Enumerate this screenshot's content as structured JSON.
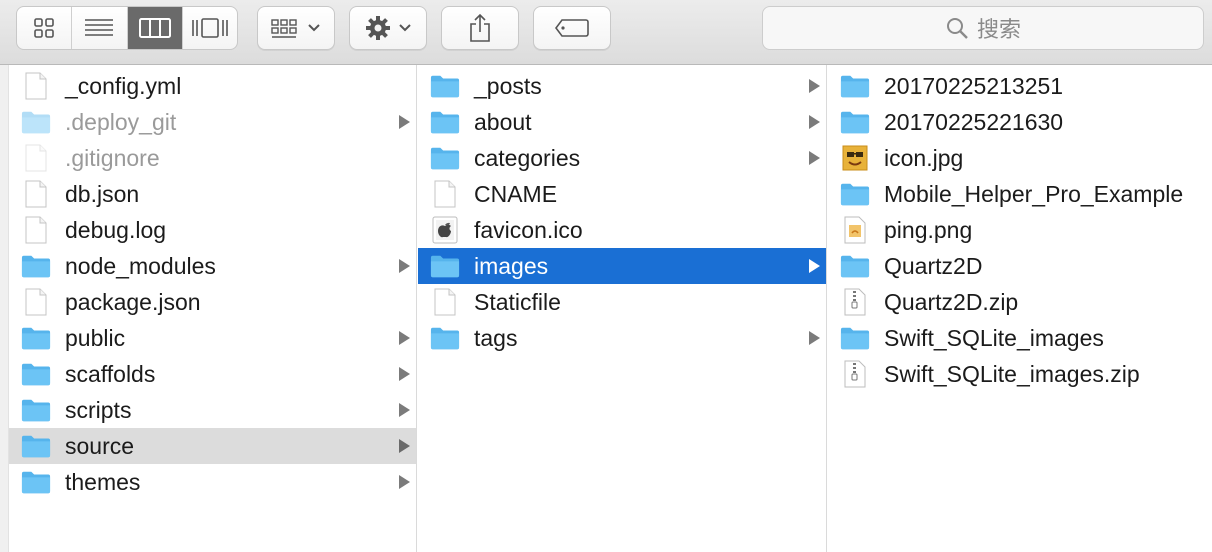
{
  "toolbar": {
    "view_modes": [
      "icon-view",
      "list-view",
      "column-view",
      "cover-flow-view"
    ],
    "active_view": "column-view",
    "search_placeholder": "搜索"
  },
  "columns": [
    {
      "items": [
        {
          "name": "_config.yml",
          "kind": "file",
          "arrow": false
        },
        {
          "name": ".deploy_git",
          "kind": "folder",
          "arrow": true,
          "dim": true
        },
        {
          "name": ".gitignore",
          "kind": "file",
          "arrow": false,
          "dim": true
        },
        {
          "name": "db.json",
          "kind": "file",
          "arrow": false
        },
        {
          "name": "debug.log",
          "kind": "file",
          "arrow": false
        },
        {
          "name": "node_modules",
          "kind": "folder",
          "arrow": true
        },
        {
          "name": "package.json",
          "kind": "file",
          "arrow": false
        },
        {
          "name": "public",
          "kind": "folder",
          "arrow": true
        },
        {
          "name": "scaffolds",
          "kind": "folder",
          "arrow": true
        },
        {
          "name": "scripts",
          "kind": "folder",
          "arrow": true
        },
        {
          "name": "source",
          "kind": "folder",
          "arrow": true,
          "selected": "inactive"
        },
        {
          "name": "themes",
          "kind": "folder",
          "arrow": true
        }
      ]
    },
    {
      "items": [
        {
          "name": "_posts",
          "kind": "folder",
          "arrow": true
        },
        {
          "name": "about",
          "kind": "folder",
          "arrow": true
        },
        {
          "name": "categories",
          "kind": "folder",
          "arrow": true
        },
        {
          "name": "CNAME",
          "kind": "file",
          "arrow": false
        },
        {
          "name": "favicon.ico",
          "kind": "ico",
          "arrow": false
        },
        {
          "name": "images",
          "kind": "folder",
          "arrow": true,
          "selected": "active"
        },
        {
          "name": "Staticfile",
          "kind": "file",
          "arrow": false
        },
        {
          "name": "tags",
          "kind": "folder",
          "arrow": true
        }
      ]
    },
    {
      "items": [
        {
          "name": "20170225213251",
          "kind": "folder",
          "arrow": false
        },
        {
          "name": "20170225221630",
          "kind": "folder",
          "arrow": false
        },
        {
          "name": "icon.jpg",
          "kind": "image",
          "arrow": false
        },
        {
          "name": "Mobile_Helper_Pro_Example",
          "kind": "folder",
          "arrow": false
        },
        {
          "name": "ping.png",
          "kind": "png",
          "arrow": false
        },
        {
          "name": "Quartz2D",
          "kind": "folder",
          "arrow": false
        },
        {
          "name": "Quartz2D.zip",
          "kind": "zip",
          "arrow": false
        },
        {
          "name": "Swift_SQLite_images",
          "kind": "folder",
          "arrow": false
        },
        {
          "name": "Swift_SQLite_images.zip",
          "kind": "zip",
          "arrow": false
        }
      ]
    }
  ],
  "colors": {
    "folder": "#6cc4f5",
    "selection_active": "#1a6fd4",
    "selection_inactive": "#dcdcdc"
  }
}
